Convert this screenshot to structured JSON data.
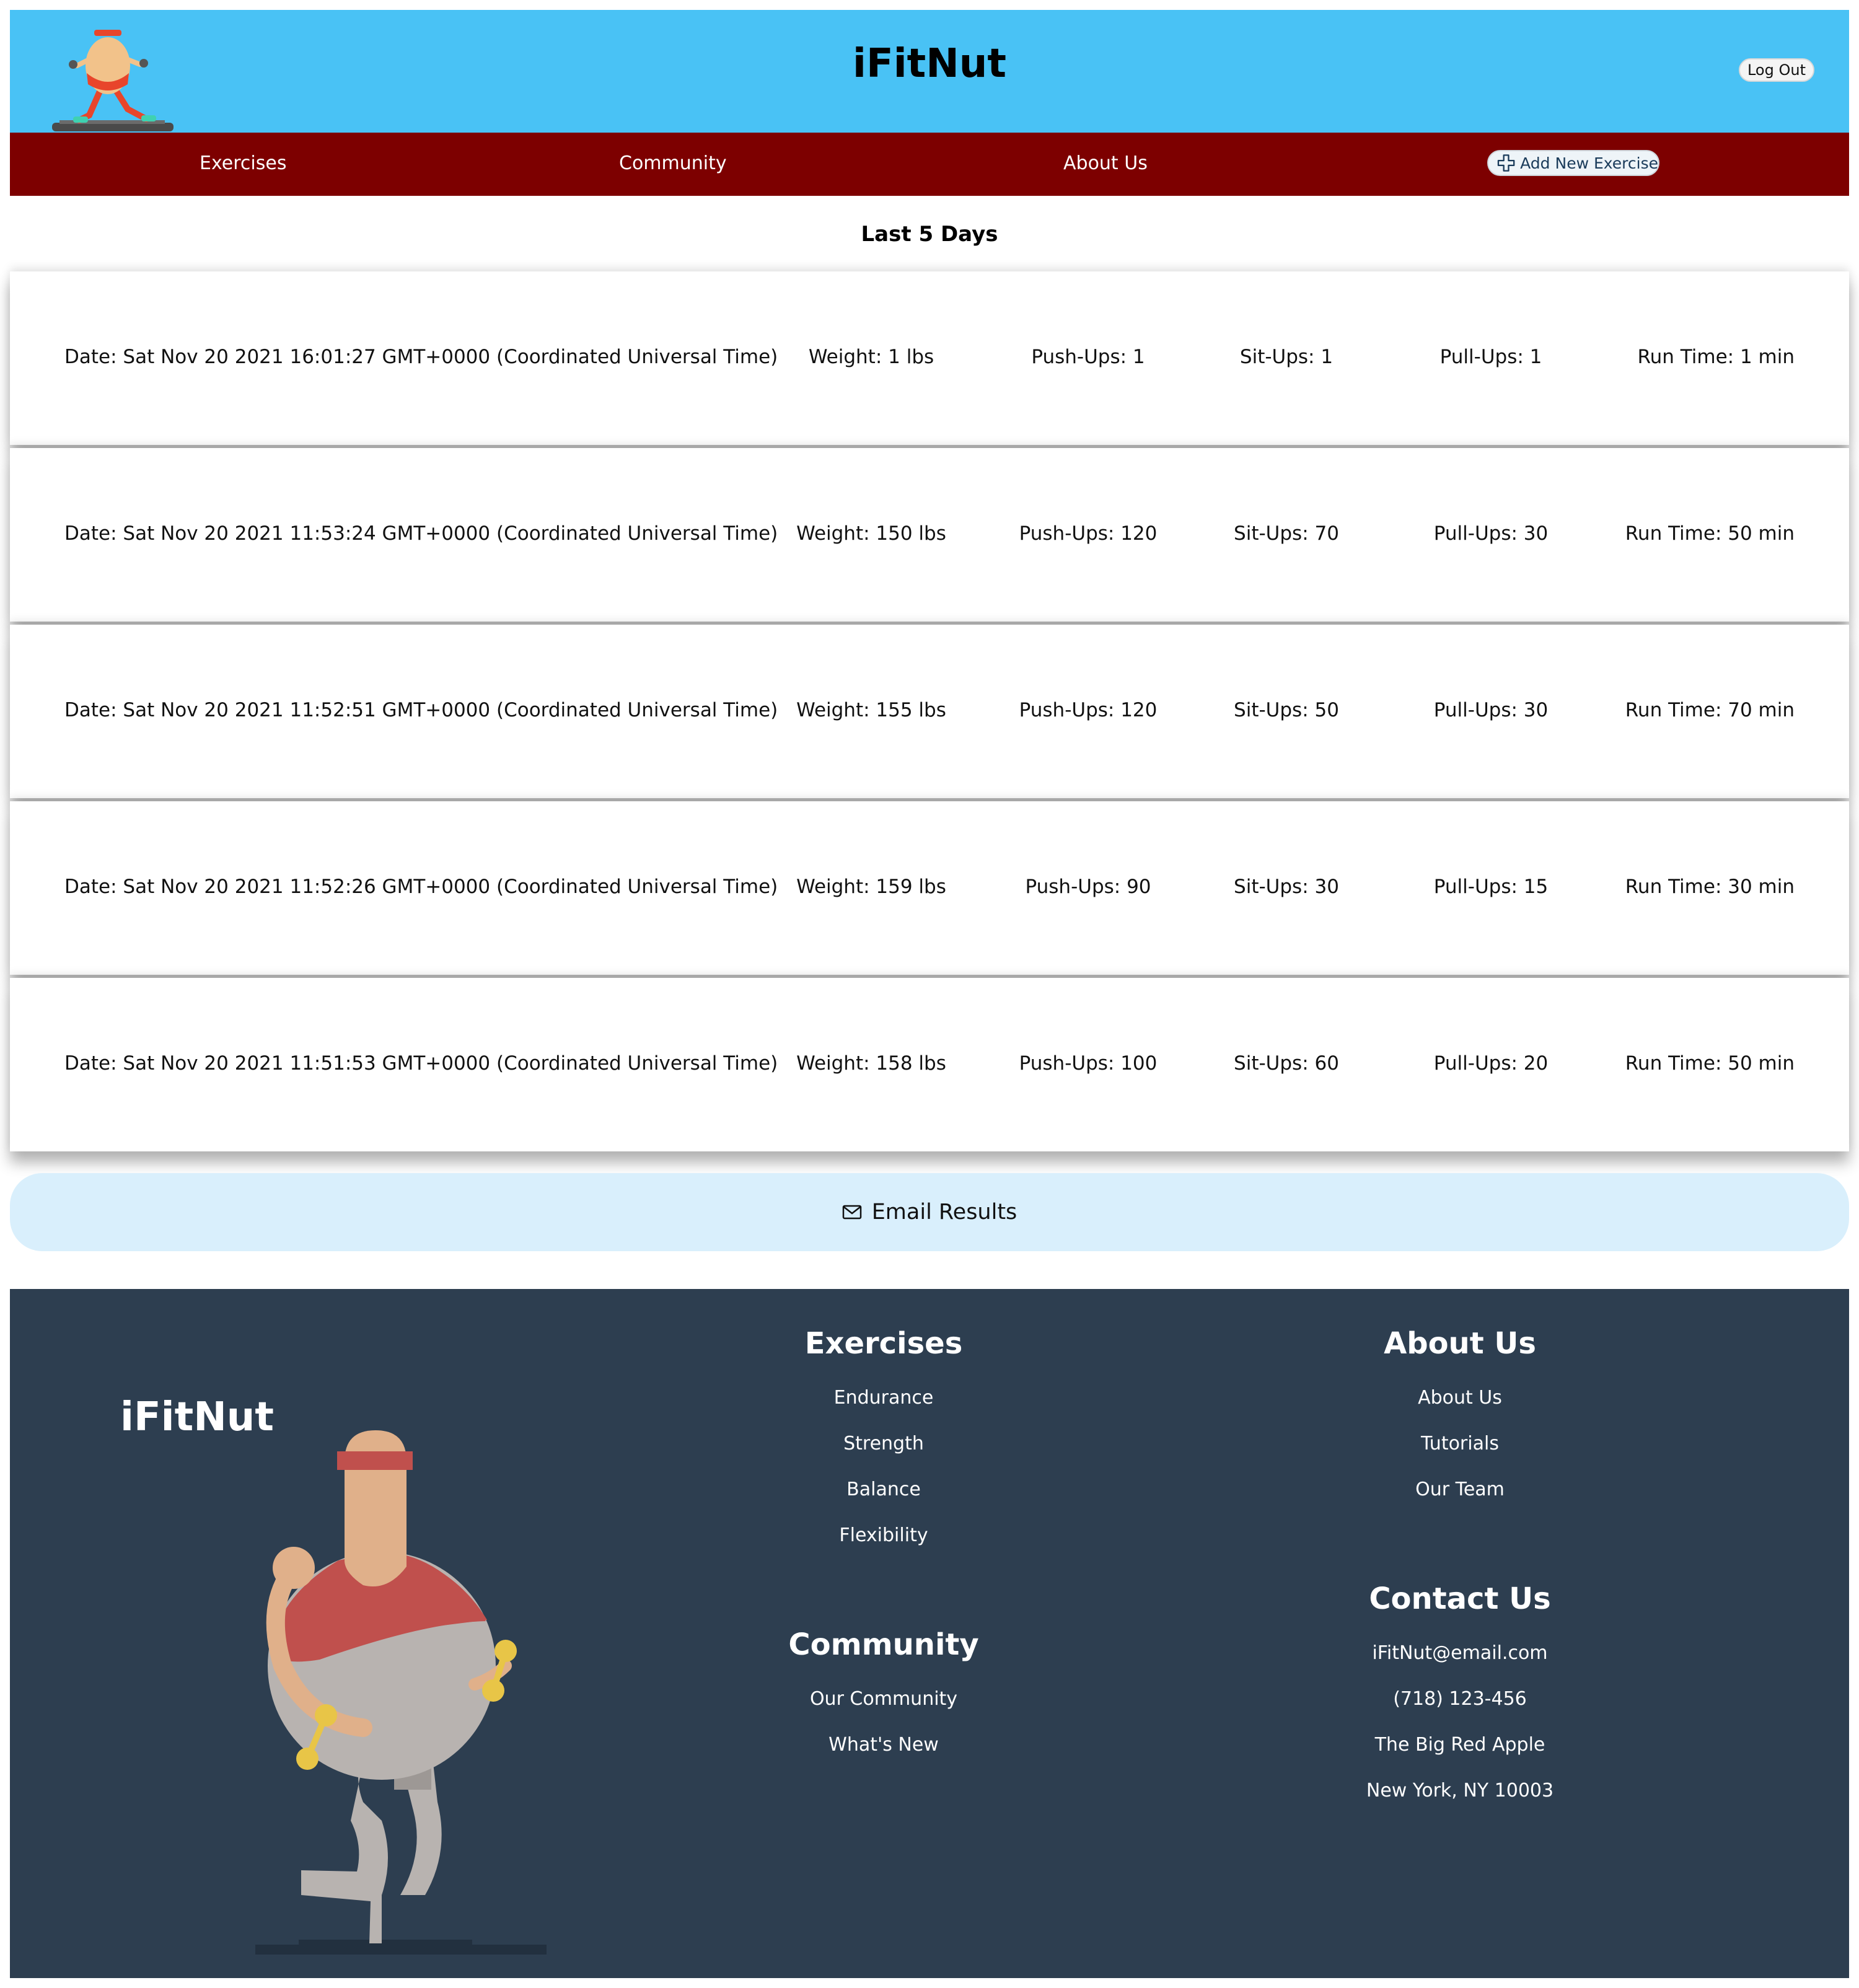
{
  "app": {
    "title": "iFitNut",
    "logout_label": "Log Out"
  },
  "nav": {
    "items": [
      {
        "label": "Exercises"
      },
      {
        "label": "Community"
      },
      {
        "label": "About Us"
      }
    ],
    "add_label": "Add New Exercise"
  },
  "section_title": "Last 5 Days",
  "entries": [
    {
      "date": "Date: Sat Nov 20 2021 16:01:27 GMT+0000 (Coordinated Universal Time)",
      "weight": "Weight: 1 lbs",
      "pushups": "Push-Ups: 1",
      "situps": "Sit-Ups: 1",
      "pullups": "Pull-Ups: 1",
      "runtime": "Run Time: 1 min"
    },
    {
      "date": "Date: Sat Nov 20 2021 11:53:24 GMT+0000 (Coordinated Universal Time)",
      "weight": "Weight: 150 lbs",
      "pushups": "Push-Ups: 120",
      "situps": "Sit-Ups: 70",
      "pullups": "Pull-Ups: 30",
      "runtime": "Run Time: 50 min"
    },
    {
      "date": "Date: Sat Nov 20 2021 11:52:51 GMT+0000 (Coordinated Universal Time)",
      "weight": "Weight: 155 lbs",
      "pushups": "Push-Ups: 120",
      "situps": "Sit-Ups: 50",
      "pullups": "Pull-Ups: 30",
      "runtime": "Run Time: 70 min"
    },
    {
      "date": "Date: Sat Nov 20 2021 11:52:26 GMT+0000 (Coordinated Universal Time)",
      "weight": "Weight: 159 lbs",
      "pushups": "Push-Ups: 90",
      "situps": "Sit-Ups: 30",
      "pullups": "Pull-Ups: 15",
      "runtime": "Run Time: 30 min"
    },
    {
      "date": "Date: Sat Nov 20 2021 11:51:53 GMT+0000 (Coordinated Universal Time)",
      "weight": "Weight: 158 lbs",
      "pushups": "Push-Ups: 100",
      "situps": "Sit-Ups: 60",
      "pullups": "Pull-Ups: 20",
      "runtime": "Run Time: 50 min"
    }
  ],
  "email_label": "Email Results",
  "footer": {
    "brand": "iFitNut",
    "exercises": {
      "heading": "Exercises",
      "links": [
        "Endurance",
        "Strength",
        "Balance",
        "Flexibility"
      ]
    },
    "community": {
      "heading": "Community",
      "links": [
        "Our Community",
        "What's New"
      ]
    },
    "about": {
      "heading": "About Us",
      "links": [
        "About Us",
        "Tutorials",
        "Our Team"
      ]
    },
    "contact": {
      "heading": "Contact Us",
      "lines": [
        "iFitNut@email.com",
        "(718) 123-456",
        "The Big Red Apple",
        "New York, NY 10003"
      ]
    }
  },
  "icons": {
    "add": "plus-icon",
    "email": "envelope-icon"
  },
  "colors": {
    "header_bg": "#49c2f5",
    "nav_bg": "#7d0000",
    "email_bg": "#d9effc",
    "footer_bg": "#2d3e50"
  }
}
